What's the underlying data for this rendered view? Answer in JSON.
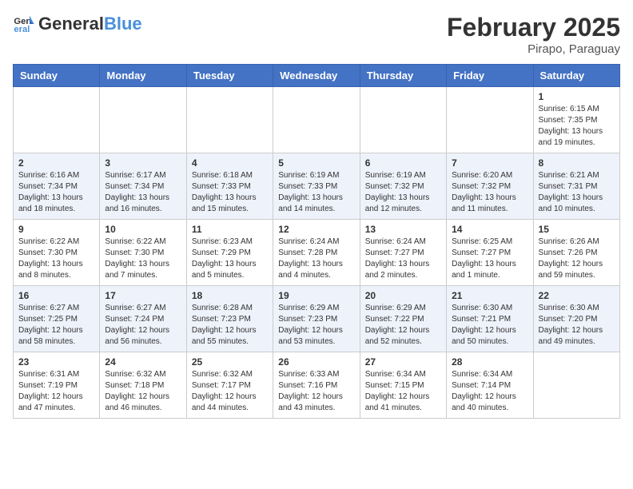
{
  "header": {
    "logo_general": "General",
    "logo_blue": "Blue",
    "month_year": "February 2025",
    "location": "Pirapo, Paraguay"
  },
  "days_of_week": [
    "Sunday",
    "Monday",
    "Tuesday",
    "Wednesday",
    "Thursday",
    "Friday",
    "Saturday"
  ],
  "weeks": [
    [
      {
        "day": "",
        "info": ""
      },
      {
        "day": "",
        "info": ""
      },
      {
        "day": "",
        "info": ""
      },
      {
        "day": "",
        "info": ""
      },
      {
        "day": "",
        "info": ""
      },
      {
        "day": "",
        "info": ""
      },
      {
        "day": "1",
        "info": "Sunrise: 6:15 AM\nSunset: 7:35 PM\nDaylight: 13 hours and 19 minutes."
      }
    ],
    [
      {
        "day": "2",
        "info": "Sunrise: 6:16 AM\nSunset: 7:34 PM\nDaylight: 13 hours and 18 minutes."
      },
      {
        "day": "3",
        "info": "Sunrise: 6:17 AM\nSunset: 7:34 PM\nDaylight: 13 hours and 16 minutes."
      },
      {
        "day": "4",
        "info": "Sunrise: 6:18 AM\nSunset: 7:33 PM\nDaylight: 13 hours and 15 minutes."
      },
      {
        "day": "5",
        "info": "Sunrise: 6:19 AM\nSunset: 7:33 PM\nDaylight: 13 hours and 14 minutes."
      },
      {
        "day": "6",
        "info": "Sunrise: 6:19 AM\nSunset: 7:32 PM\nDaylight: 13 hours and 12 minutes."
      },
      {
        "day": "7",
        "info": "Sunrise: 6:20 AM\nSunset: 7:32 PM\nDaylight: 13 hours and 11 minutes."
      },
      {
        "day": "8",
        "info": "Sunrise: 6:21 AM\nSunset: 7:31 PM\nDaylight: 13 hours and 10 minutes."
      }
    ],
    [
      {
        "day": "9",
        "info": "Sunrise: 6:22 AM\nSunset: 7:30 PM\nDaylight: 13 hours and 8 minutes."
      },
      {
        "day": "10",
        "info": "Sunrise: 6:22 AM\nSunset: 7:30 PM\nDaylight: 13 hours and 7 minutes."
      },
      {
        "day": "11",
        "info": "Sunrise: 6:23 AM\nSunset: 7:29 PM\nDaylight: 13 hours and 5 minutes."
      },
      {
        "day": "12",
        "info": "Sunrise: 6:24 AM\nSunset: 7:28 PM\nDaylight: 13 hours and 4 minutes."
      },
      {
        "day": "13",
        "info": "Sunrise: 6:24 AM\nSunset: 7:27 PM\nDaylight: 13 hours and 2 minutes."
      },
      {
        "day": "14",
        "info": "Sunrise: 6:25 AM\nSunset: 7:27 PM\nDaylight: 13 hours and 1 minute."
      },
      {
        "day": "15",
        "info": "Sunrise: 6:26 AM\nSunset: 7:26 PM\nDaylight: 12 hours and 59 minutes."
      }
    ],
    [
      {
        "day": "16",
        "info": "Sunrise: 6:27 AM\nSunset: 7:25 PM\nDaylight: 12 hours and 58 minutes."
      },
      {
        "day": "17",
        "info": "Sunrise: 6:27 AM\nSunset: 7:24 PM\nDaylight: 12 hours and 56 minutes."
      },
      {
        "day": "18",
        "info": "Sunrise: 6:28 AM\nSunset: 7:23 PM\nDaylight: 12 hours and 55 minutes."
      },
      {
        "day": "19",
        "info": "Sunrise: 6:29 AM\nSunset: 7:23 PM\nDaylight: 12 hours and 53 minutes."
      },
      {
        "day": "20",
        "info": "Sunrise: 6:29 AM\nSunset: 7:22 PM\nDaylight: 12 hours and 52 minutes."
      },
      {
        "day": "21",
        "info": "Sunrise: 6:30 AM\nSunset: 7:21 PM\nDaylight: 12 hours and 50 minutes."
      },
      {
        "day": "22",
        "info": "Sunrise: 6:30 AM\nSunset: 7:20 PM\nDaylight: 12 hours and 49 minutes."
      }
    ],
    [
      {
        "day": "23",
        "info": "Sunrise: 6:31 AM\nSunset: 7:19 PM\nDaylight: 12 hours and 47 minutes."
      },
      {
        "day": "24",
        "info": "Sunrise: 6:32 AM\nSunset: 7:18 PM\nDaylight: 12 hours and 46 minutes."
      },
      {
        "day": "25",
        "info": "Sunrise: 6:32 AM\nSunset: 7:17 PM\nDaylight: 12 hours and 44 minutes."
      },
      {
        "day": "26",
        "info": "Sunrise: 6:33 AM\nSunset: 7:16 PM\nDaylight: 12 hours and 43 minutes."
      },
      {
        "day": "27",
        "info": "Sunrise: 6:34 AM\nSunset: 7:15 PM\nDaylight: 12 hours and 41 minutes."
      },
      {
        "day": "28",
        "info": "Sunrise: 6:34 AM\nSunset: 7:14 PM\nDaylight: 12 hours and 40 minutes."
      },
      {
        "day": "",
        "info": ""
      }
    ]
  ]
}
